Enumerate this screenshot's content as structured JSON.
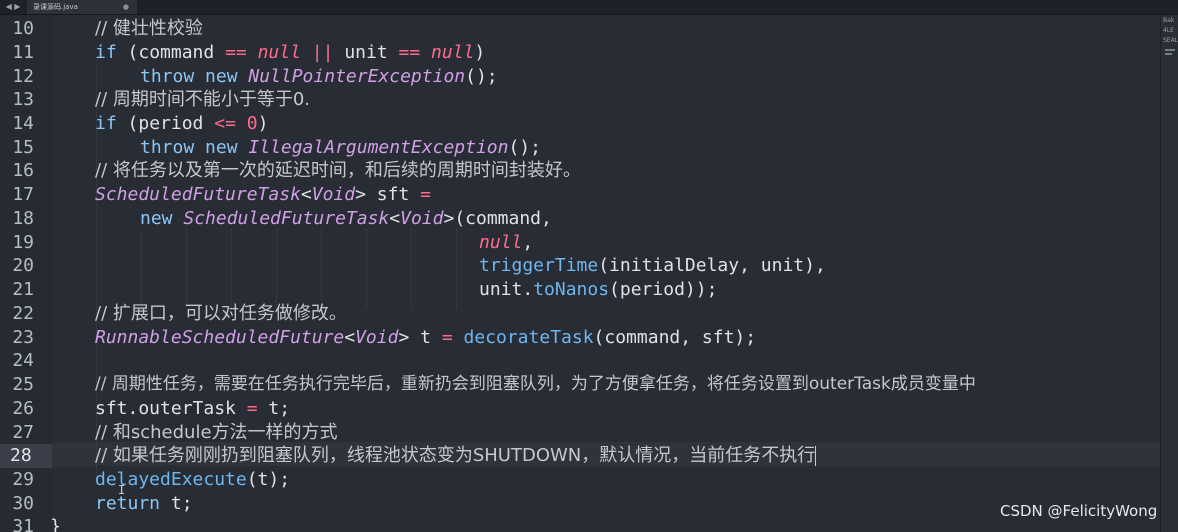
{
  "tab": {
    "filename": "录课源码.java",
    "arrows": "◀ ▶",
    "close": "●"
  },
  "line_numbers": [
    "10",
    "11",
    "12",
    "13",
    "14",
    "15",
    "16",
    "17",
    "18",
    "19",
    "20",
    "21",
    "22",
    "23",
    "24",
    "25",
    "26",
    "27",
    "28",
    "29",
    "30",
    "31"
  ],
  "active_line": "28",
  "code": {
    "l10": "// 健壮性校验",
    "l11": {
      "kw_if": "if",
      "p1": " (command ",
      "eq1": "==",
      "null1": "null",
      "or": "||",
      "p2": " unit ",
      "eq2": "==",
      "null2": "null",
      "p3": ")"
    },
    "l12": {
      "kw": "throw new ",
      "cls": "NullPointerException",
      "rest": "();"
    },
    "l13": "// 周期时间不能小于等于0.",
    "l14": {
      "kw": "if",
      "p1": " (period ",
      "op": "<=",
      "num": "0",
      "p2": ")"
    },
    "l15": {
      "kw": "throw new ",
      "cls": "IllegalArgumentException",
      "rest": "();"
    },
    "l16": "// 将任务以及第一次的延迟时间，和后续的周期时间封装好。",
    "l17": {
      "cls": "ScheduledFutureTask",
      "lt": "<",
      "gen": "Void",
      "gt": ">",
      "rest": " sft ",
      "eq": "="
    },
    "l18": {
      "kw": "new ",
      "cls": "ScheduledFutureTask",
      "lt": "<",
      "gen": "Void",
      "gt": ">",
      "rest": "(command,"
    },
    "l19": {
      "nul": "null",
      "rest": ","
    },
    "l20": {
      "fn": "triggerTime",
      "rest": "(initialDelay, unit),"
    },
    "l21": {
      "a": "unit.",
      "fn": "toNanos",
      "rest": "(period));"
    },
    "l22": "// 扩展口，可以对任务做修改。",
    "l23": {
      "cls": "RunnableScheduledFuture",
      "lt": "<",
      "gen": "Void",
      "gt": ">",
      "p1": " t ",
      "eq": "=",
      "fn": "decorateTask",
      "rest": "(command, sft);"
    },
    "l25": "// 周期性任务，需要在任务执行完毕后，重新扔会到阻塞队列，为了方便拿任务，将任务设置到outerTask成员变量中",
    "l26": {
      "a": "sft.outerTask ",
      "eq": "=",
      "rest": " t;"
    },
    "l27": "// 和schedule方法一样的方式",
    "l28": "// 如果任务刚刚扔到阻塞队列，线程池状态变为SHUTDOWN，默认情况，当前任务不执行",
    "l29": {
      "fn": "delayedExecute",
      "rest": "(t);"
    },
    "l30": {
      "kw": "return",
      "rest": " t;"
    },
    "l31": "}"
  },
  "minimap_labels": [
    "Bak",
    "4LE",
    "SEAL"
  ],
  "watermark": "CSDN @FelicityWong",
  "colors": {
    "background": "#282c34",
    "keyword": "#8bc6f5",
    "operator": "#ff6b8b",
    "class": "#d19fe6",
    "function": "#6fb6ee"
  }
}
